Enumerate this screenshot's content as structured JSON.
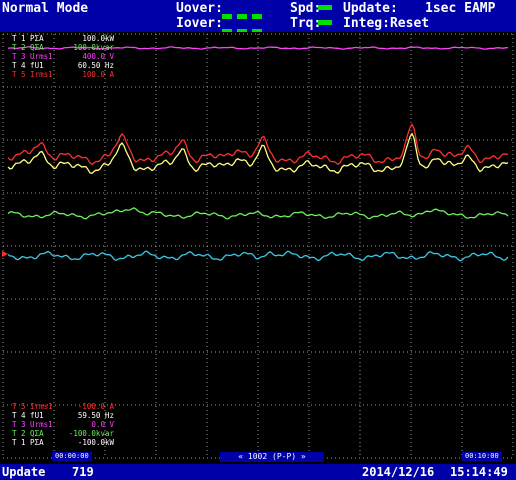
{
  "header": {
    "mode": "Normal Mode",
    "uover_label": "Uover:",
    "iover_label": "Iover:",
    "spd_label": "Spd:",
    "trq_label": "Trq:",
    "update_label": "Update:",
    "update_value": "1sec EAMP",
    "integ_label": "Integ:Reset",
    "indicator_color": "#00e000"
  },
  "legend_top": [
    {
      "name": "T 1 PΣA",
      "value": "100.0kW",
      "color": "#ffffff"
    },
    {
      "name": "T 2 QΣA",
      "value": "100.0kvar",
      "color": "#6cf05c"
    },
    {
      "name": "T 3 Urms1",
      "value": "400.0 V",
      "color": "#ff40ff"
    },
    {
      "name": "T 4 fU1",
      "value": "60.50 Hz",
      "color": "#ffffff"
    },
    {
      "name": "T 5 Irms1",
      "value": "100.0 A",
      "color": "#ff3030"
    }
  ],
  "legend_bottom": [
    {
      "name": "T 5 Irms1",
      "value": "-100.0 A",
      "color": "#ff3030"
    },
    {
      "name": "T 4 fU1",
      "value": "59.50 Hz",
      "color": "#ffffff"
    },
    {
      "name": "T 3 Urms1",
      "value": "0.0 V",
      "color": "#ff40ff"
    },
    {
      "name": "T 2 QΣA",
      "value": "-100.0kvar",
      "color": "#6cf05c"
    },
    {
      "name": "T 1 PΣA",
      "value": "-100.0kW",
      "color": "#ffffff"
    }
  ],
  "time_start": "00:00:00",
  "time_end": "00:10:00",
  "zoom_label": "« 1002 (P-P) »",
  "status": {
    "update_label": "Update",
    "update_count": "719",
    "date": "2014/12/16",
    "time": "15:14:49"
  },
  "colors": {
    "background": "#000000",
    "frame": "#0000a8",
    "grid": "#9a9a9a"
  }
}
